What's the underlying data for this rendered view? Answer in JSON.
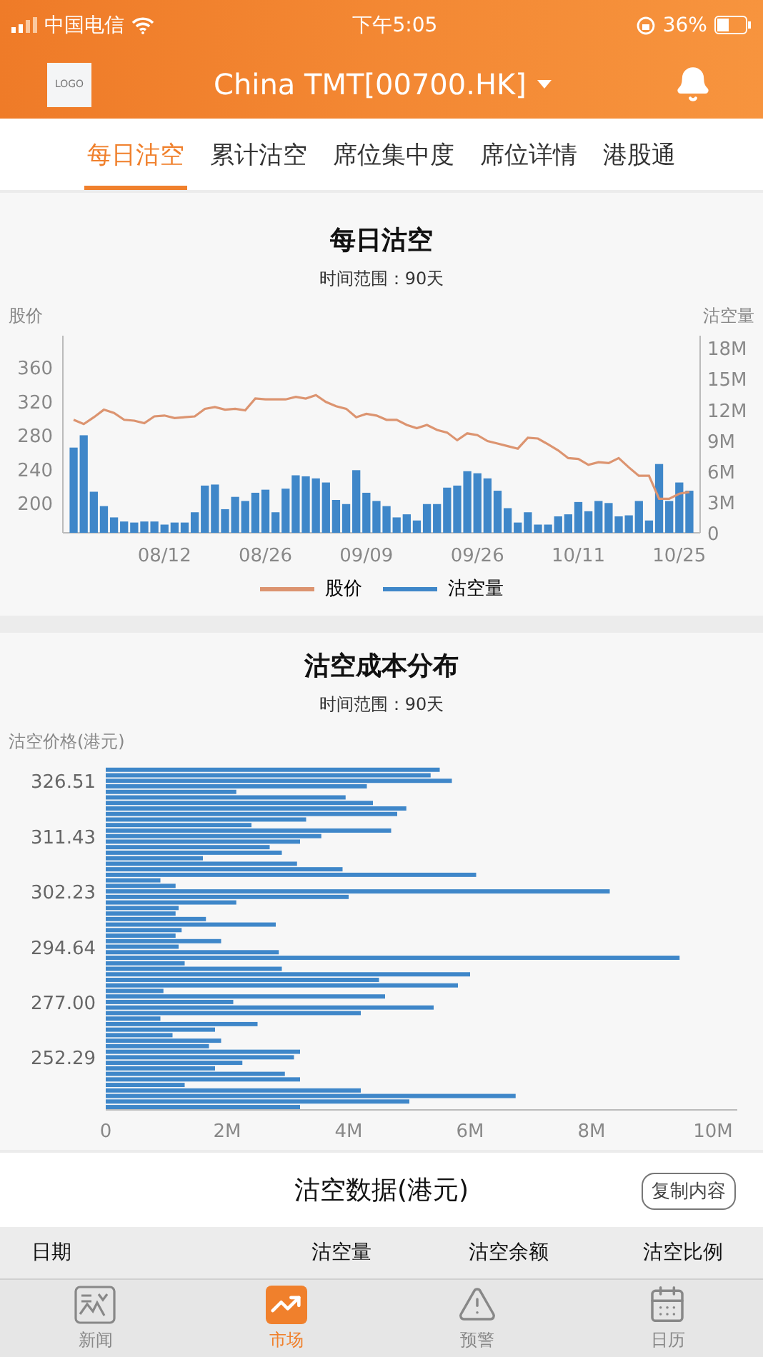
{
  "status_bar": {
    "carrier": "中国电信",
    "time": "下午5:05",
    "battery": "36%"
  },
  "header": {
    "logo": "LOGO",
    "title": "China TMT[00700.HK]"
  },
  "tabs": [
    {
      "label": "每日沽空",
      "selected": true
    },
    {
      "label": "累计沽空",
      "selected": false
    },
    {
      "label": "席位集中度",
      "selected": false
    },
    {
      "label": "席位详情",
      "selected": false
    },
    {
      "label": "港股通",
      "selected": false
    }
  ],
  "daily_chart": {
    "title": "每日沽空",
    "subtitle": "时间范围：90天",
    "volume": {
      "chart_data": {
        "type": "bar",
        "ylabel": "沽空量",
        "categories": [
          null,
          null,
          null,
          null,
          null,
          null,
          null,
          null,
          null,
          "08/12",
          null,
          null,
          null,
          null,
          null,
          null,
          null,
          null,
          null,
          "08/26",
          null,
          null,
          null,
          null,
          null,
          null,
          null,
          null,
          null,
          "09/09",
          null,
          null,
          null,
          null,
          null,
          null,
          null,
          null,
          null,
          null,
          "09/26",
          null,
          null,
          null,
          null,
          null,
          null,
          null,
          null,
          null,
          "10/11",
          null,
          null,
          null,
          null,
          null,
          null,
          null,
          null,
          null,
          "10/25",
          null
        ],
        "yticks": [
          {
            "value": 0,
            "label": "0"
          },
          {
            "value": 3000000,
            "label": "3M"
          },
          {
            "value": 6000000,
            "label": "6M"
          },
          {
            "value": 9000000,
            "label": "9M"
          },
          {
            "value": 12000000,
            "label": "12M"
          },
          {
            "value": 15000000,
            "label": "15M"
          },
          {
            "value": 18000000,
            "label": "18M"
          }
        ],
        "ylim": [
          0,
          19200000
        ],
        "series": [
          {
            "name": "沽空量",
            "color": "#3f87c9",
            "values": [
              8300000,
              9500000,
              4000000,
              2600000,
              1500000,
              1100000,
              1000000,
              1100000,
              1100000,
              800000,
              1000000,
              1000000,
              2000000,
              4600000,
              4700000,
              2300000,
              3500000,
              3100000,
              3900000,
              4200000,
              2000000,
              4300000,
              5600000,
              5500000,
              5300000,
              4900000,
              3200000,
              2800000,
              6100000,
              3900000,
              3100000,
              2600000,
              1500000,
              1800000,
              1200000,
              2800000,
              2800000,
              4400000,
              4600000,
              6000000,
              5800000,
              5300000,
              4100000,
              2400000,
              1000000,
              2000000,
              800000,
              800000,
              1600000,
              1800000,
              3000000,
              2100000,
              3100000,
              2900000,
              1600000,
              1700000,
              3100000,
              1200000,
              6700000,
              3100000,
              4900000,
              4100000
            ]
          }
        ]
      }
    },
    "price": {
      "chart_data": {
        "type": "line",
        "ylabel": "股价",
        "yticks": [
          200,
          240,
          280,
          320,
          360
        ],
        "ylim": [
          165,
          397
        ],
        "series": [
          {
            "name": "股价",
            "color": "#dc9470",
            "values": [
              298,
              293,
              301,
              310,
              306,
              298,
              297,
              294,
              302,
              303,
              300,
              301,
              302,
              311,
              313,
              310,
              311,
              309,
              323,
              322,
              322,
              322,
              325,
              323,
              327,
              319,
              314,
              311,
              301,
              305,
              303,
              298,
              298,
              292,
              288,
              292,
              286,
              283,
              274,
              282,
              280,
              273,
              270,
              267,
              264,
              277,
              276,
              269,
              262,
              253,
              252,
              245,
              248,
              247,
              253,
              242,
              232,
              232,
              205,
              205,
              211,
              213
            ]
          }
        ]
      }
    }
  },
  "cost_chart": {
    "title": "沽空成本分布",
    "subtitle": "时间范围：90天",
    "chart_data": {
      "type": "bar",
      "orientation": "horizontal",
      "ylabel": "沽空价格(港元)",
      "categories": [
        null,
        null,
        "326.51",
        null,
        null,
        null,
        null,
        null,
        null,
        null,
        null,
        null,
        "311.43",
        null,
        null,
        null,
        null,
        null,
        null,
        null,
        null,
        null,
        "302.23",
        null,
        null,
        null,
        null,
        null,
        null,
        null,
        null,
        null,
        "294.64",
        null,
        null,
        null,
        null,
        null,
        null,
        null,
        null,
        null,
        "277.00",
        null,
        null,
        null,
        null,
        null,
        null,
        null,
        null,
        null,
        "252.29",
        null,
        null,
        null,
        null,
        null,
        null,
        null,
        null,
        null
      ],
      "xticks": [
        {
          "value": 0,
          "label": "0"
        },
        {
          "value": 2000000,
          "label": "2M"
        },
        {
          "value": 4000000,
          "label": "4M"
        },
        {
          "value": 6000000,
          "label": "6M"
        },
        {
          "value": 8000000,
          "label": "8M"
        },
        {
          "value": 10000000,
          "label": "10M"
        }
      ],
      "xlim": [
        0,
        10400000
      ],
      "series": [
        {
          "color": "#3f87c9",
          "values": [
            5500000,
            5350000,
            5700000,
            4300000,
            2150000,
            3950000,
            4400000,
            4950000,
            4800000,
            3300000,
            2400000,
            4700000,
            3550000,
            3200000,
            2700000,
            2900000,
            1600000,
            3150000,
            3900000,
            6100000,
            900000,
            1150000,
            8300000,
            4000000,
            2150000,
            1200000,
            1150000,
            1650000,
            2800000,
            1250000,
            1150000,
            1900000,
            1200000,
            2850000,
            9450000,
            1300000,
            2900000,
            6000000,
            4500000,
            5800000,
            950000,
            4600000,
            2100000,
            5400000,
            4200000,
            900000,
            2500000,
            1800000,
            1100000,
            1900000,
            1700000,
            3200000,
            3100000,
            2250000,
            1800000,
            2950000,
            3200000,
            1300000,
            4200000,
            6750000,
            5000000,
            3200000
          ]
        }
      ]
    }
  },
  "data_section": {
    "title": "沽空数据(港元)",
    "copy_button": "复制内容",
    "columns": [
      "日期",
      "沽空量",
      "沽空余额",
      "沽空比例"
    ]
  },
  "bottom_tabs": [
    {
      "label": "新闻",
      "kind": "news",
      "selected": false
    },
    {
      "label": "市场",
      "kind": "market",
      "selected": true
    },
    {
      "label": "预警",
      "kind": "alert",
      "selected": false
    },
    {
      "label": "日历",
      "kind": "calendar",
      "selected": false
    }
  ]
}
